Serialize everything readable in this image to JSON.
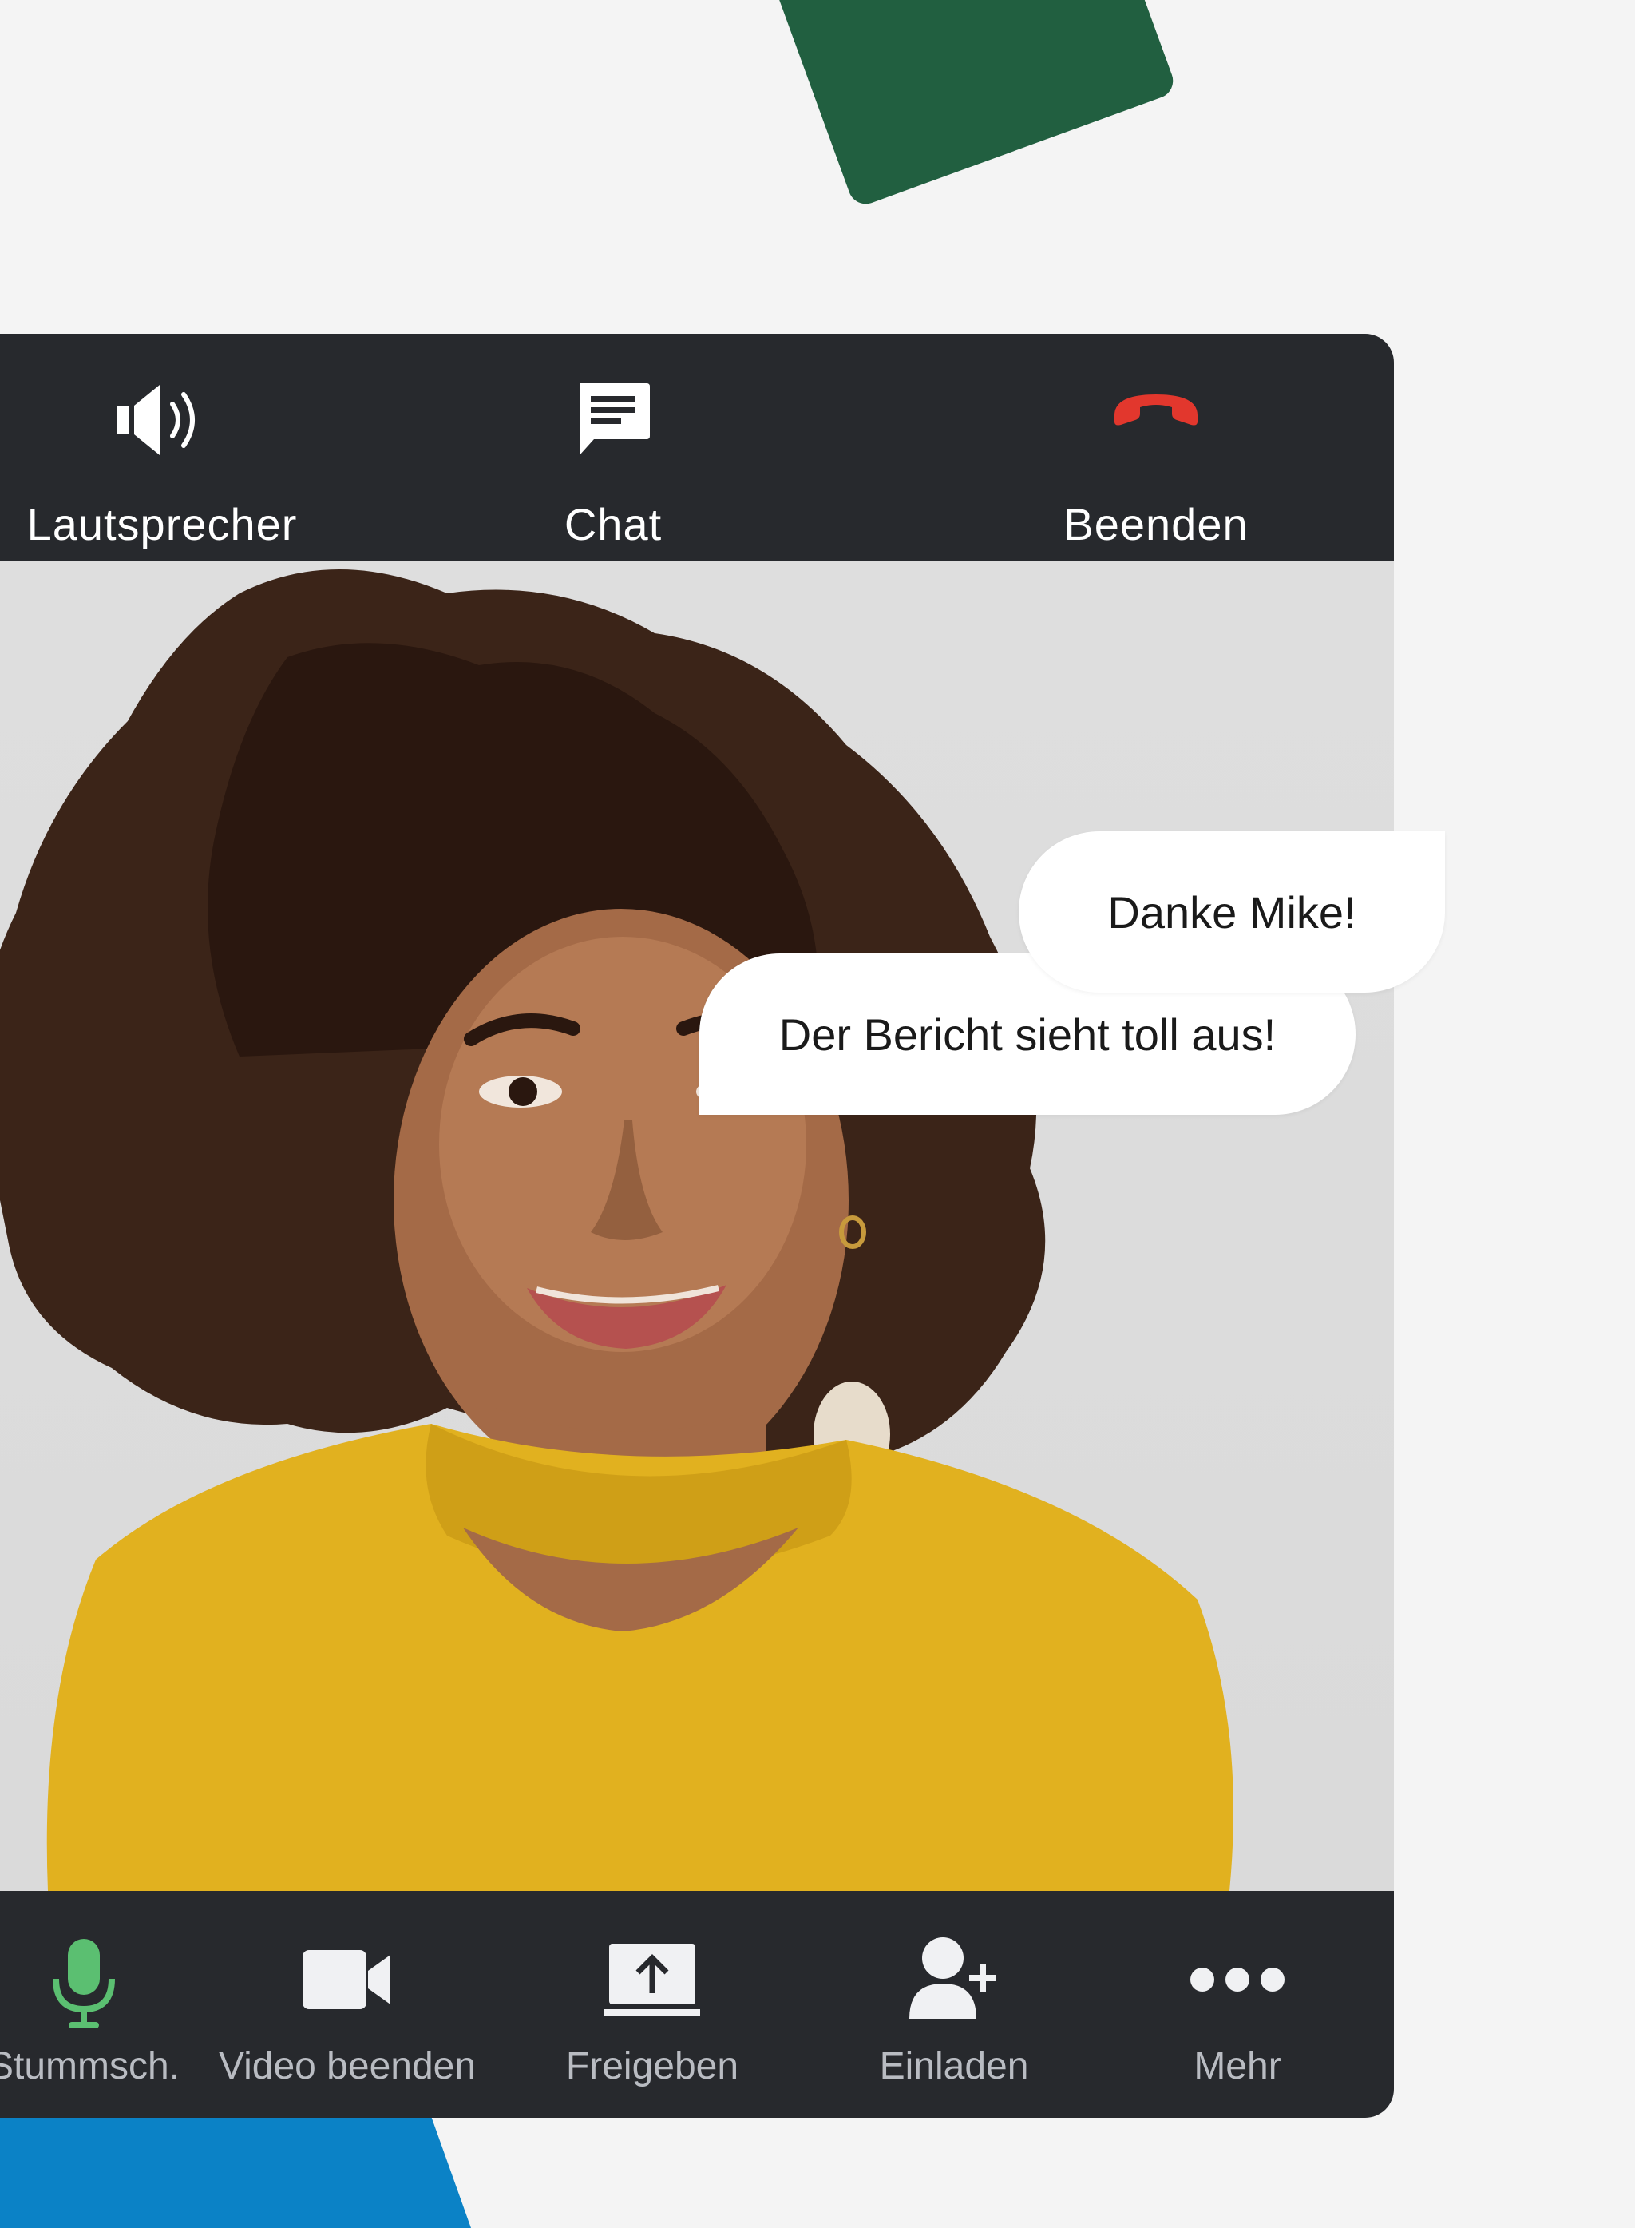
{
  "colors": {
    "background": "#f4f4f4",
    "toolbar": "#27292d",
    "accent_green": "#215f40",
    "accent_blue": "#0b82c6",
    "end_call_red": "#e2372d",
    "mic_green": "#5bbf71"
  },
  "top_toolbar": {
    "speaker": {
      "label": "Lautsprecher",
      "icon": "speaker-icon"
    },
    "chat": {
      "label": "Chat",
      "icon": "chat-icon"
    },
    "end": {
      "label": "Beenden",
      "icon": "end-call-icon"
    }
  },
  "chat_messages": [
    {
      "text": "Der Bericht sieht toll aus!"
    },
    {
      "text": "Danke Mike!"
    }
  ],
  "bottom_toolbar": {
    "mute": {
      "label": "Stummsch.",
      "icon": "microphone-icon"
    },
    "video": {
      "label": "Video beenden",
      "icon": "video-camera-icon"
    },
    "share": {
      "label": "Freigeben",
      "icon": "share-screen-icon"
    },
    "invite": {
      "label": "Einladen",
      "icon": "add-person-icon"
    },
    "more": {
      "label": "Mehr",
      "icon": "more-dots-icon"
    }
  }
}
